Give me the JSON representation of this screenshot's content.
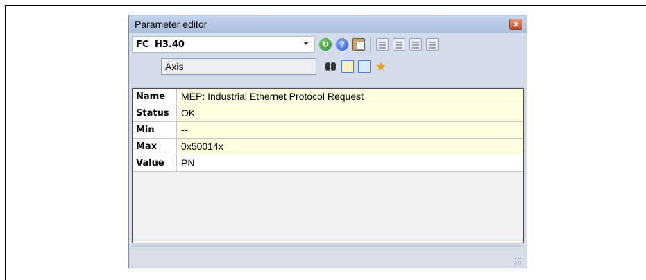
{
  "window": {
    "title": "Parameter editor",
    "close_glyph": "x"
  },
  "toolbar": {
    "fc_label": "FC",
    "fc_code": "H3.40",
    "icons": [
      "dropdown-arrow-icon",
      "refresh-icon",
      "help-icon",
      "paste-icon",
      "move-up-icon",
      "move-down-icon",
      "grid-disabled-icon",
      "grid-check-icon"
    ]
  },
  "axis": {
    "value": "Axis",
    "icons": [
      "binoculars-icon",
      "grid-yellow-icon",
      "import-icon",
      "star-icon"
    ]
  },
  "table": {
    "rows": [
      {
        "key": "Name",
        "value": "MEP: Industrial Ethernet Protocol Request",
        "style": "yellow"
      },
      {
        "key": "Status",
        "value": "OK",
        "style": "yellow"
      },
      {
        "key": "Min",
        "value": "--",
        "style": "yellow"
      },
      {
        "key": "Max",
        "value": "0x50014x",
        "style": "yellow"
      },
      {
        "key": "Value",
        "value": "PN",
        "style": "white"
      }
    ]
  },
  "colors": {
    "titlebar": "#b7cbe6",
    "readonly_row": "#ffffe1",
    "editable_row": "#ffffff",
    "close_button": "#d0563a"
  }
}
